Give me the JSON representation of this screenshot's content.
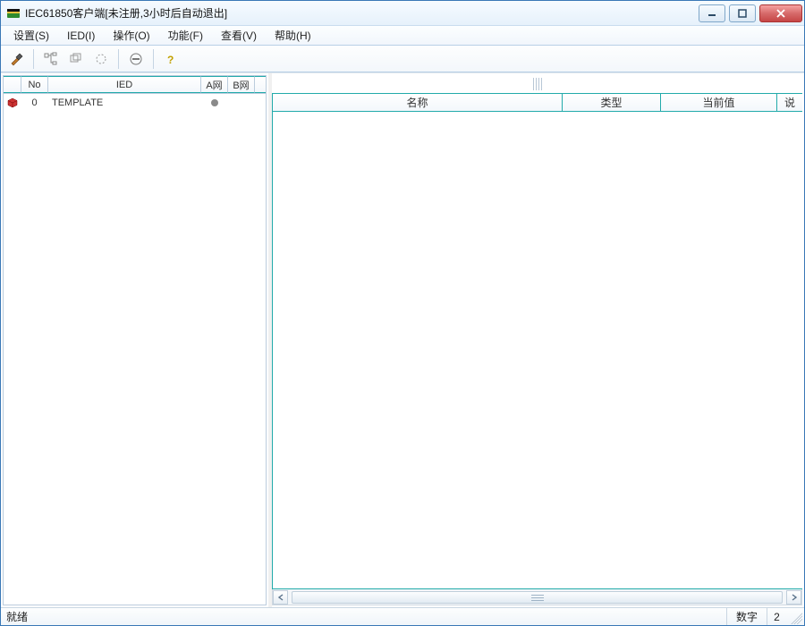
{
  "window": {
    "title": "IEC61850客户端[未注册,3小时后自动退出]"
  },
  "menu": {
    "settings": "设置(S)",
    "ied": "IED(I)",
    "operate": "操作(O)",
    "function": "功能(F)",
    "view": "查看(V)",
    "help": "帮助(H)"
  },
  "ied_table": {
    "headers": {
      "no": "No",
      "ied": "IED",
      "a": "A网",
      "b": "B网"
    },
    "rows": [
      {
        "no": "0",
        "ied": "TEMPLATE",
        "a_status": "offline",
        "b_status": ""
      }
    ]
  },
  "right_table": {
    "headers": {
      "name": "名称",
      "type": "类型",
      "value": "当前值",
      "extra": "说"
    }
  },
  "status": {
    "ready": "就绪",
    "numlock": "数字",
    "num": "2"
  }
}
